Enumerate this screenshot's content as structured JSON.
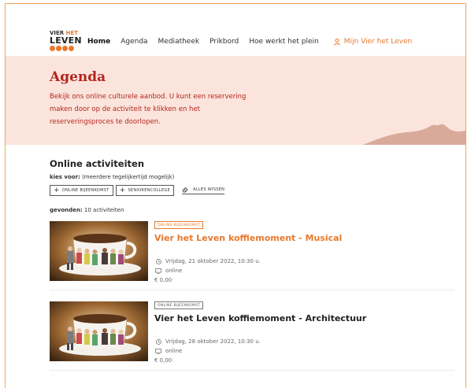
{
  "logo": {
    "line1a": "VIER",
    "line1b": "HET",
    "line2": "LEVEN"
  },
  "nav": {
    "items": [
      {
        "label": "Home"
      },
      {
        "label": "Agenda"
      },
      {
        "label": "Mediatheek"
      },
      {
        "label": "Prikbord"
      },
      {
        "label": "Hoe werkt het plein"
      }
    ],
    "account_label": "Mijn Vier het Leven"
  },
  "hero": {
    "title": "Agenda",
    "text": "Bekijk ons online culturele aanbod. U kunt een reservering maken door op de activiteit te klikken en het reserveringsproces te doorlopen."
  },
  "filters": {
    "section_title": "Online activiteiten",
    "kies_label": "kies voor:",
    "kies_hint": "(meerdere tegelijkertijd mogelijk)",
    "chips": [
      "online bijeenkomst",
      "seniorencollege"
    ],
    "clear_label": "alles wissen"
  },
  "results": {
    "label": "gevonden:",
    "count": "10 activiteiten"
  },
  "activities": [
    {
      "badge": "online bijeenkomst",
      "title": "Vier het Leven koffiemoment - Musical",
      "date": "Vrijdag, 21 oktober 2022, 10:30 u.",
      "location": "online",
      "price": "€ 0,00"
    },
    {
      "badge": "online bijeenkomst",
      "title": "Vier het Leven koffiemoment - Architectuur",
      "date": "Vrijdag, 28 oktober 2022, 10:30 u.",
      "location": "online",
      "price": "€ 0,00"
    }
  ],
  "colors": {
    "accent": "#e8792d",
    "hero_bg": "#fbe4dc",
    "hero_text": "#b3261e"
  },
  "icons": [
    "user-icon",
    "plus-icon",
    "eraser-icon",
    "clock-icon",
    "monitor-icon",
    "euro-icon"
  ]
}
